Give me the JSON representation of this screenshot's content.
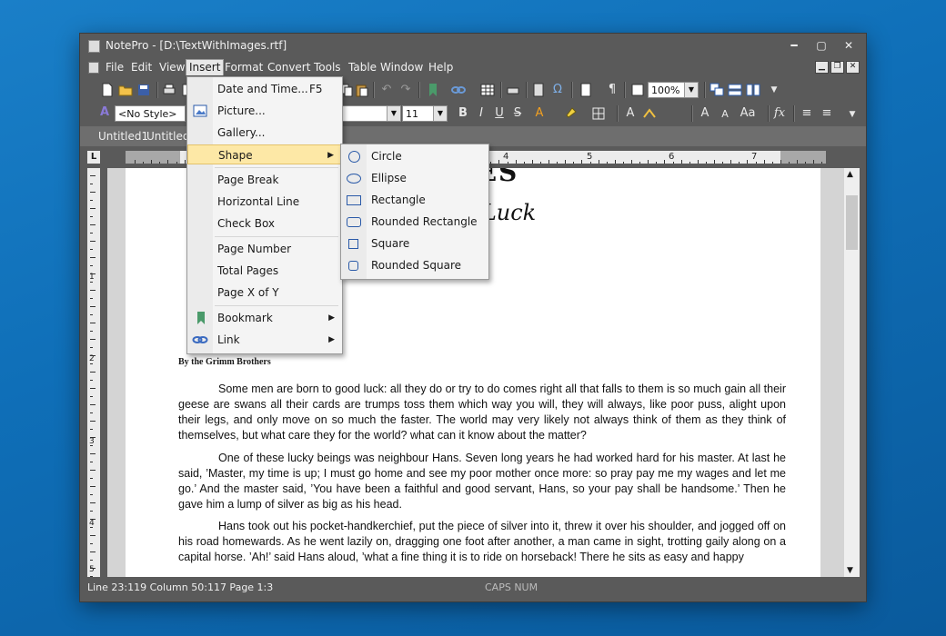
{
  "window": {
    "title": "NotePro - [D:\\TextWithImages.rtf]"
  },
  "window_controls": {
    "minimize": "━",
    "maximize": "▢",
    "close": "✕"
  },
  "menubar": {
    "items": [
      "File",
      "Edit",
      "View",
      "Insert",
      "Format",
      "Convert",
      "Tools",
      "Table",
      "Window",
      "Help"
    ],
    "active": "Insert"
  },
  "toolbar": {
    "zoom": "100%",
    "style": "<No Style>",
    "font_size": "11"
  },
  "format_glyphs": {
    "bold": "B",
    "italic": "I",
    "underline": "U",
    "strike": "S",
    "font_color": "A",
    "upper": "A",
    "grow": "A",
    "shrink": "A",
    "case": "Aa",
    "fx": "fx"
  },
  "doc_tabs": [
    "Untitled1",
    "Untitled2"
  ],
  "ruler": {
    "numbers": [
      "1",
      "2",
      "3",
      "4",
      "5",
      "6",
      "7"
    ],
    "v_numbers": [
      "1",
      "2",
      "3",
      "4",
      "5"
    ]
  },
  "insert_menu": {
    "items": [
      {
        "label": "Date and Time...",
        "shortcut": "F5"
      },
      {
        "label": "Picture..."
      },
      {
        "label": "Gallery..."
      },
      {
        "label": "Shape",
        "submenu": true
      },
      {
        "label": "Page Break"
      },
      {
        "label": "Horizontal Line"
      },
      {
        "label": "Check Box"
      },
      {
        "label": "Page Number"
      },
      {
        "label": "Total Pages"
      },
      {
        "label": "Page X of Y"
      },
      {
        "label": "Bookmark",
        "submenu": true
      },
      {
        "label": "Link",
        "submenu": true
      }
    ]
  },
  "shape_submenu": {
    "items": [
      "Circle",
      "Ellipse",
      "Rectangle",
      "Rounded Rectangle",
      "Square",
      "Rounded Square"
    ]
  },
  "document": {
    "heading_fragment": "TALES",
    "subheading_fragment": "e Luck",
    "byline": "By the Grimm Brothers",
    "paragraphs": [
      "Some men are born to good luck: all they do or try to do comes right   all that falls to them is so much gain  all their geese are swans  all their cards are trumps  toss them which way you will, they will always, like poor puss, alight upon their legs, and only move on so much the faster. The world may very likely not always think of them as they think of themselves, but what care they for the world? what can it know about the matter?",
      "One of these lucky beings was neighbour Hans. Seven long years he had worked hard for his master. At last he said, ’Master, my time is up; I must go home and see my poor mother once more: so pray pay me my wages and let me go.’ And the master said, ’You have been a faithful and good servant, Hans, so your pay shall be handsome.’ Then he gave him a lump of silver as big as his head.",
      "Hans took out his pocket-handkerchief, put the piece of silver into it, threw it over his shoulder, and jogged off on his road homewards. As he went lazily on, dragging one foot after another, a man came in sight, trotting gaily along on a capital horse. ’Ah!’ said Hans aloud, ’what a fine thing it is to ride on horseback! There he sits as easy and happy"
    ]
  },
  "status": {
    "position": "Line 23:119  Column 50:117  Page 1:3",
    "indicators": "CAPS NUM"
  }
}
